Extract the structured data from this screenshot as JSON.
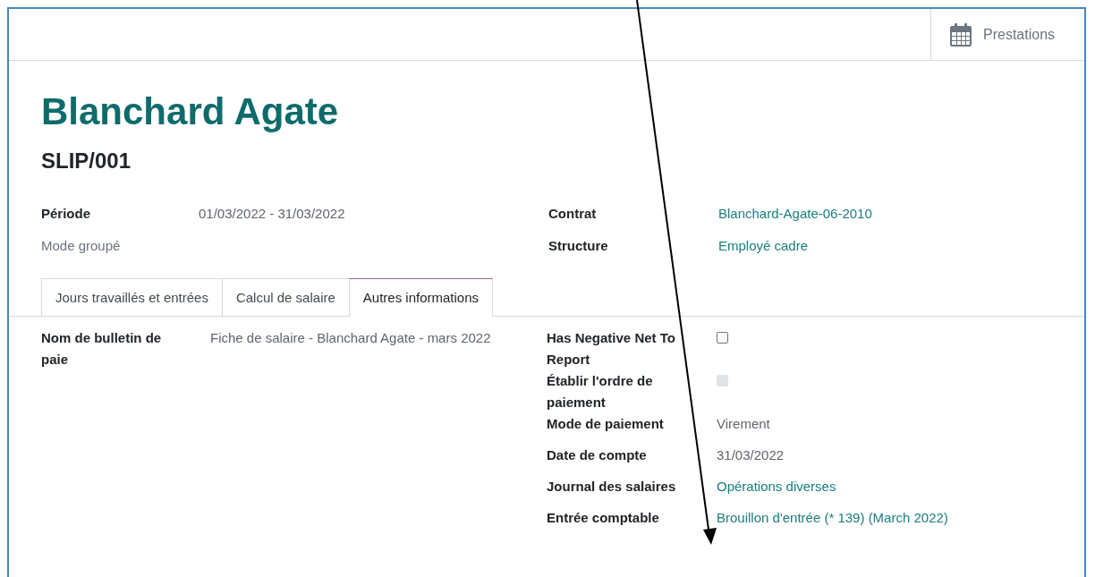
{
  "toolbar": {
    "button": "Prestations"
  },
  "record": {
    "title": "Blanchard Agate",
    "reference": "SLIP/001"
  },
  "header_left": [
    {
      "label": "Période",
      "value": "01/03/2022 - 31/03/2022",
      "kind": "text"
    },
    {
      "label": "Mode groupé",
      "kind": "muted"
    }
  ],
  "header_right": [
    {
      "label": "Contrat",
      "value": "Blanchard-Agate-06-2010",
      "kind": "link"
    },
    {
      "label": "Structure",
      "value": "Employé cadre",
      "kind": "link"
    }
  ],
  "tabs": [
    {
      "label": "Jours travaillés et entrées",
      "selected": false
    },
    {
      "label": "Calcul de salaire",
      "selected": false
    },
    {
      "label": "Autres informations",
      "selected": true
    }
  ],
  "tab_left": [
    {
      "label": "Nom de bulletin de paie",
      "value": "Fiche de salaire - Blanchard Agate - mars 2022",
      "kind": "text"
    }
  ],
  "tab_right": [
    {
      "label": "Has Negative Net To Report",
      "kind": "checkbox",
      "checked": false,
      "disabled": false
    },
    {
      "label": "Établir l'ordre de paiement",
      "kind": "checkbox",
      "checked": false,
      "disabled": true
    },
    {
      "label": "Mode de paiement",
      "value": "Virement",
      "kind": "text"
    },
    {
      "label": "Date de compte",
      "value": "31/03/2022",
      "kind": "text"
    },
    {
      "label": "Journal des salaires",
      "value": "Opérations diverses",
      "kind": "link"
    },
    {
      "label": "Entrée comptable",
      "value": "Brouillon d'entrée (* 139) (March 2022)",
      "kind": "link"
    }
  ]
}
